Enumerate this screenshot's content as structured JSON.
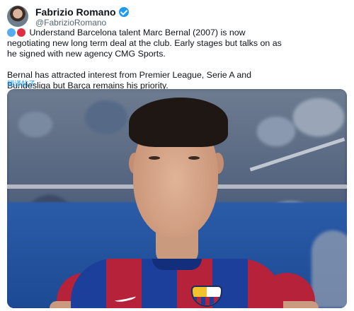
{
  "tweet": {
    "author": {
      "display_name": "Fabrizio Romano",
      "handle": "@FabrizioRomano",
      "verified": true
    },
    "text_lines": [
      "Understand Barcelona talent Marc Bernal (2007) is now",
      "negotiating new long term deal at the club. Early stages but talks on as",
      "he signed with new agency CMG Sports.",
      "Bernal has attracted interest from Premier League, Serie A and",
      "Bundesliga but Barça remains his priority."
    ],
    "translate_label": "翻译帖子",
    "emoji_dots": [
      "#55acee",
      "#dd2e44"
    ]
  },
  "colors": {
    "accent": "#1d9bf0",
    "text": "#0f1419",
    "muted": "#536471"
  }
}
